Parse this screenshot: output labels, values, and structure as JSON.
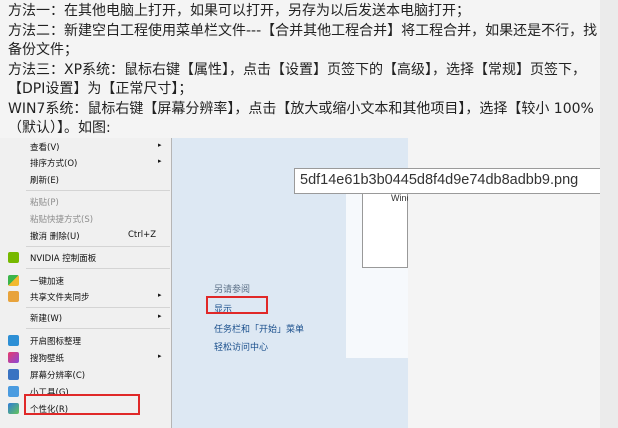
{
  "article": {
    "lines": [
      "方法一：在其他电脑上打开，如果可以打开，另存为以后发送本电脑打开；",
      "方法二：新建空白工程使用菜单栏文件---【合并其他工程合并】将工程合并，如果还是不行，找备份文件；",
      "方法三：XP系统：鼠标右键【属性】，点击【设置】页签下的【高级】，选择【常规】页签下，【DPI设置】为【正常尺寸】；",
      "WIN7系统：鼠标右键【屏幕分辨率】，点击【放大或缩小文本和其他项目】，选择【较小 100%（默认）】。如图:"
    ]
  },
  "context_menu": {
    "items": [
      {
        "label": "查看(V)",
        "arrow": "▸"
      },
      {
        "label": "排序方式(O)",
        "arrow": "▸"
      },
      {
        "label": "刷新(E)"
      },
      {
        "label": "粘贴(P)"
      },
      {
        "label": "粘贴快捷方式(S)"
      },
      {
        "label": "撤消 删除(U)",
        "shortcut": "Ctrl+Z"
      },
      {
        "label": "NVIDIA 控制面板"
      },
      {
        "label": "一键加速"
      },
      {
        "label": "共享文件夹同步",
        "arrow": "▸"
      },
      {
        "label": "新建(W)",
        "arrow": "▸"
      },
      {
        "label": "开启图标整理"
      },
      {
        "label": "搜狗壁纸",
        "arrow": "▸"
      },
      {
        "label": "屏幕分辨率(C)"
      },
      {
        "label": "小工具(G)"
      },
      {
        "label": "个性化(R)"
      }
    ]
  },
  "see_also": {
    "heading": "另请参阅",
    "links": [
      "显示",
      "任务栏和「开始」菜单",
      "轻松访问中心"
    ]
  },
  "dialog_text": "Wind",
  "filename_tooltip": "5df14e61b3b0445d8f4d9e74db8adbb9.png",
  "colors": {
    "highlight_red": "#e02828",
    "link_blue": "#1a4f8c",
    "panel_blue": "#dde8f3"
  }
}
